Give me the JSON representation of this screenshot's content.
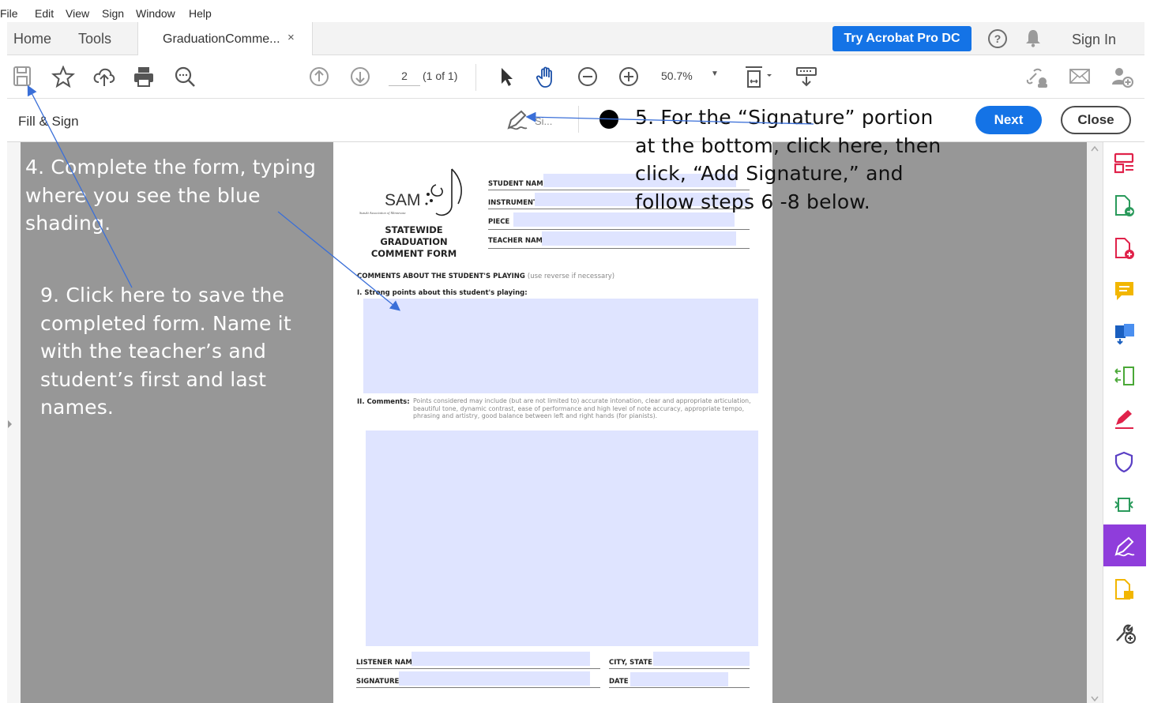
{
  "menu": [
    "File",
    "Edit",
    "View",
    "Sign",
    "Window",
    "Help"
  ],
  "tabs": {
    "home": "Home",
    "tools": "Tools",
    "document": "GraduationComme...",
    "close_glyph": "×"
  },
  "header": {
    "try_button": "Try Acrobat Pro DC",
    "help_glyph": "?",
    "sign_in": "Sign In"
  },
  "toolbar": {
    "page_number": "2",
    "page_of": "(1 of 1)",
    "zoom": "50.7%",
    "zoom_caret": "▼"
  },
  "fill_sign": {
    "title": "Fill & Sign",
    "sign_label": "Si...",
    "next": "Next",
    "close": "Close"
  },
  "form": {
    "sam_text": "SAM",
    "sam_subtitle": "Suzuki Association of Minnesota",
    "title_line1": "STATEWIDE GRADUATION",
    "title_line2": "COMMENT FORM",
    "student_name": "STUDENT NAME",
    "instrument": "INSTRUMENT",
    "piece": "PIECE",
    "teacher_name": "TEACHER NAME",
    "comments_heading": "COMMENTS ABOUT THE STUDENT'S PLAYING",
    "comments_hint": "(use reverse if necessary)",
    "strong_points": "I. Strong points about this student's playing:",
    "comments_label": "II. Comments:",
    "comments_text": "Points considered may include (but are not limited to) accurate intonation, clear and appropriate articulation, beautiful tone, dynamic contrast, ease of performance and high level of note accuracy, appropriate tempo, phrasing and artistry, good balance between left and right hands (for pianists).",
    "listener_name": "LISTENER NAME",
    "city_state": "CITY, STATE",
    "signature": "SIGNATURE",
    "date": "DATE"
  },
  "annotations": {
    "step4": "4.  Complete the form, typing where you see the blue shading.",
    "step5": "5.  For the “Signature” portion at the bottom, click here, then click, “Add Signature,” and follow steps 6 -8 below.",
    "step9": "9.  Click here to save the completed form. Name it with the teacher’s and student’s first and last names."
  },
  "colors": {
    "accent": "#1473e6",
    "form_field": "#dfe4ff",
    "workspace": "#979797",
    "active_tool": "#8f3ddb",
    "arrow": "#3a6fd8"
  },
  "icons": {
    "toolbar": [
      "save-icon",
      "star-icon",
      "upload-icon",
      "print-icon",
      "zoom-search-icon",
      "page-up-icon",
      "page-down-icon",
      "select-arrow-icon",
      "hand-icon",
      "zoom-out-icon",
      "zoom-in-icon",
      "page-fit-icon",
      "keyboard-icon",
      "share-link-icon",
      "email-icon",
      "add-user-icon"
    ],
    "right_rail": [
      "organize-icon",
      "export-pdf-icon",
      "create-pdf-icon",
      "comment-icon",
      "combine-icon",
      "compress-icon",
      "sign-pen-icon",
      "protect-icon",
      "send-icon",
      "fill-sign-icon",
      "sticky-icon",
      "more-tools-icon"
    ]
  }
}
